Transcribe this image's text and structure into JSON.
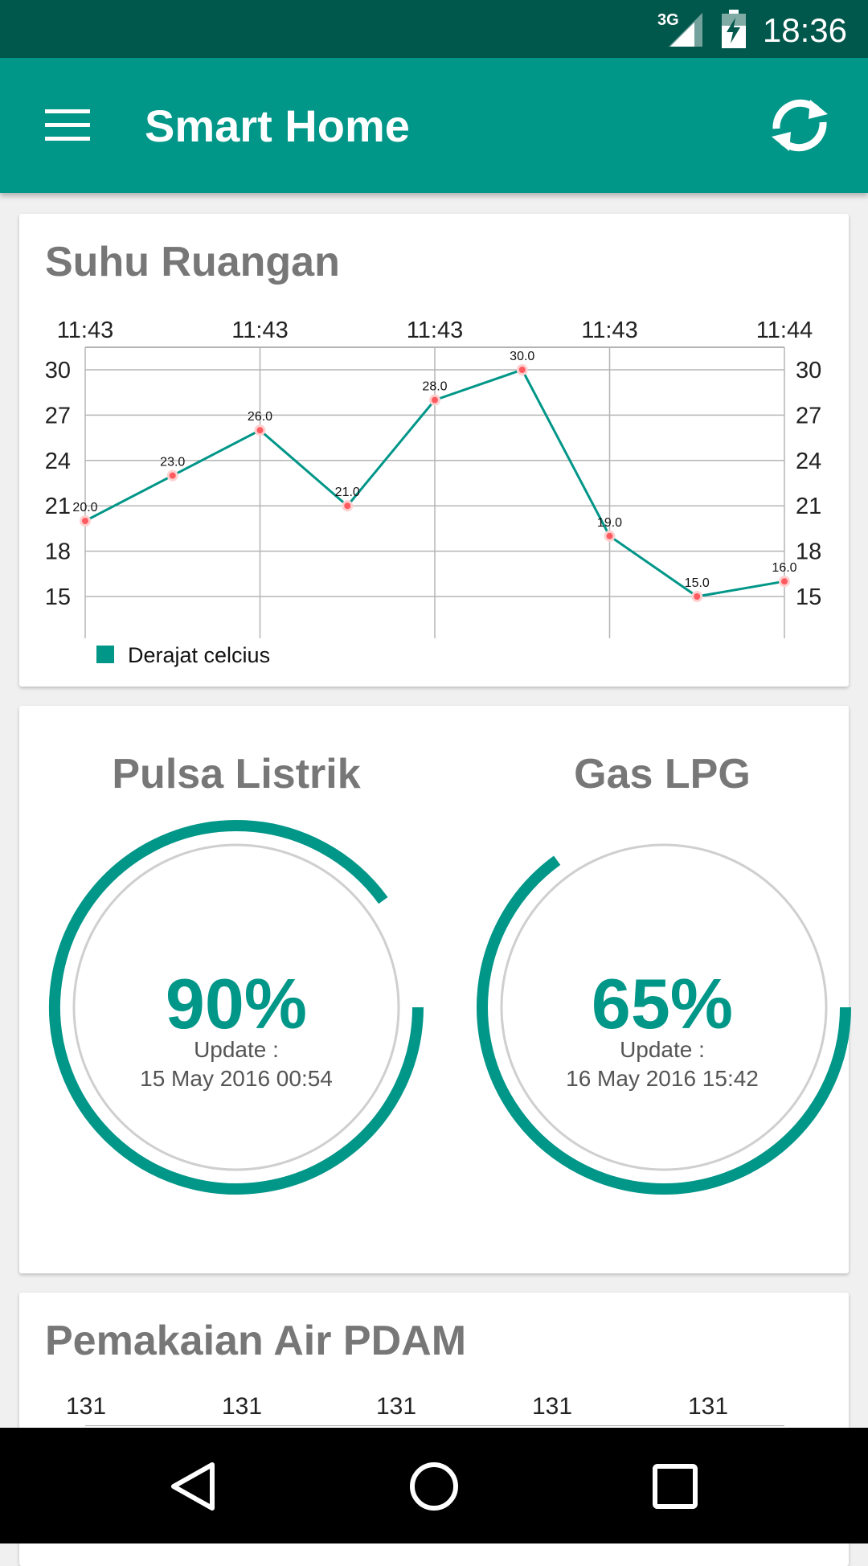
{
  "status": {
    "network": "3G",
    "time": "18:36"
  },
  "app_bar": {
    "title": "Smart Home",
    "menu_icon": "hamburger-menu-icon",
    "refresh_icon": "refresh-icon"
  },
  "colors": {
    "primary": "#009688",
    "primary_dark": "#00574b",
    "point": "#ff5a5f",
    "card_title": "#777777"
  },
  "temperature_card": {
    "title": "Suhu Ruangan",
    "chart_data": {
      "type": "line",
      "x_ticks": [
        "11:43",
        "11:43",
        "11:43",
        "11:43",
        "11:44"
      ],
      "y_ticks": [
        30,
        27,
        24,
        21,
        18,
        15
      ],
      "ylim": [
        15,
        30
      ],
      "grid": true,
      "legend_position": "bottom-left",
      "series": [
        {
          "name": "Derajat celcius",
          "values": [
            20.0,
            23.0,
            26.0,
            21.0,
            28.0,
            30.0,
            19.0,
            15.0,
            16.0
          ]
        }
      ]
    }
  },
  "gauges": [
    {
      "title": "Pulsa Listrik",
      "percent": 90,
      "percent_label": "90%",
      "update_label": "Update :",
      "update_time": "15 May 2016 00:54"
    },
    {
      "title": "Gas LPG",
      "percent": 65,
      "percent_label": "65%",
      "update_label": "Update :",
      "update_time": "16 May 2016 15:42"
    }
  ],
  "water_card": {
    "title": "Pemakaian Air PDAM",
    "x_ticks": [
      "131",
      "131",
      "131",
      "131",
      "131"
    ]
  },
  "nav": {
    "back_icon": "back-triangle-icon",
    "home_icon": "home-circle-icon",
    "recents_icon": "recents-square-icon"
  }
}
